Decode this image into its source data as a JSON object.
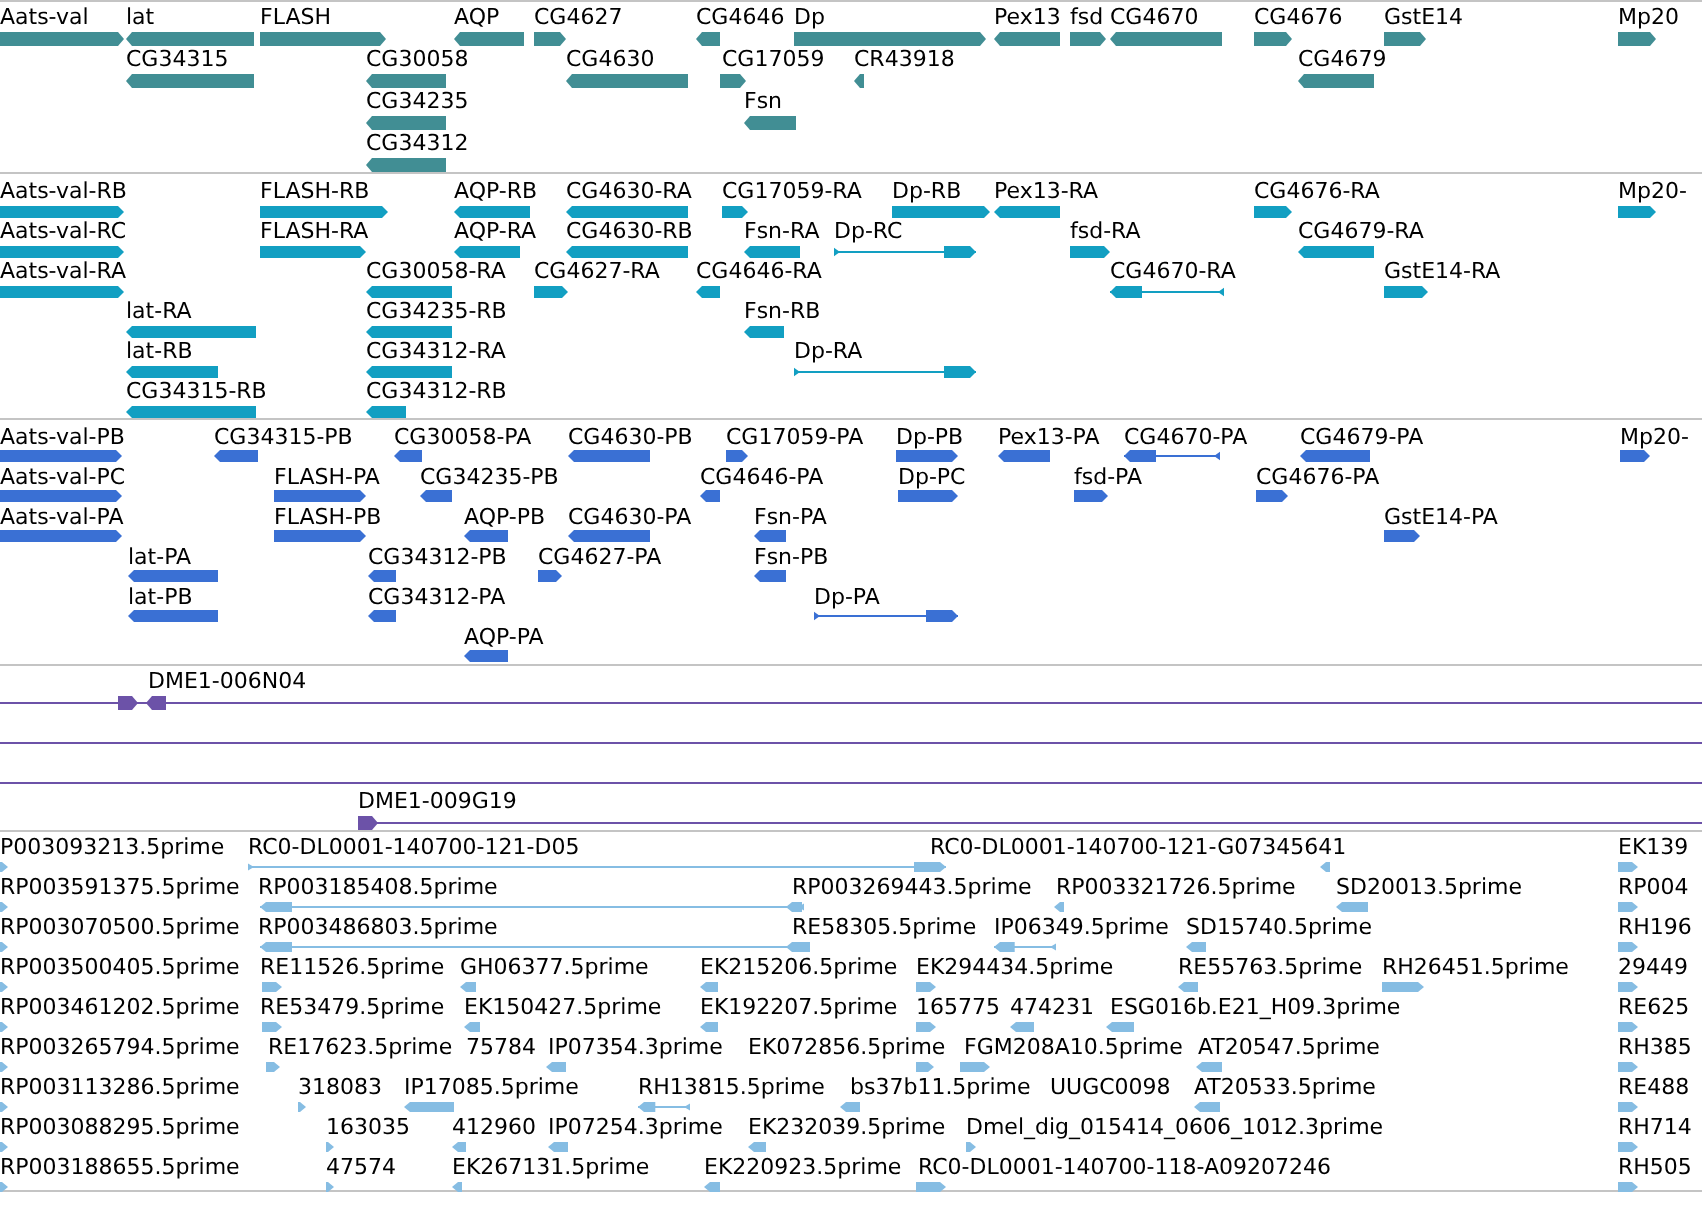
{
  "tracks": [
    {
      "color": "#418e94",
      "rows": [
        {
          "features": [
            {
              "label": "Aats-val",
              "reverse": false
            },
            {
              "label": "lat",
              "reverse": true
            },
            {
              "label": "FLASH",
              "reverse": false
            },
            {
              "label": "AQP",
              "reverse": true
            },
            {
              "label": "CG4627",
              "reverse": false
            },
            {
              "label": "CG4646",
              "reverse": true
            },
            {
              "label": "Dp",
              "reverse": false
            },
            {
              "label": "Pex13",
              "reverse": true
            },
            {
              "label": "fsd",
              "reverse": false
            },
            {
              "label": "CG4670",
              "reverse": true
            },
            {
              "label": "CG4676",
              "reverse": false
            },
            {
              "label": "GstE14",
              "reverse": false
            },
            {
              "label": "Mp20",
              "reverse": false
            }
          ]
        },
        {
          "features": [
            {
              "label": "CG34315",
              "reverse": true
            },
            {
              "label": "CG30058",
              "reverse": true
            },
            {
              "label": "CG4630",
              "reverse": true
            },
            {
              "label": "CG17059",
              "reverse": false
            },
            {
              "label": "CR43918",
              "reverse": true
            },
            {
              "label": "CG4679",
              "reverse": true
            }
          ]
        },
        {
          "features": [
            {
              "label": "CG34235",
              "reverse": true
            },
            {
              "label": "Fsn",
              "reverse": true
            }
          ]
        },
        {
          "features": [
            {
              "label": "CG34312",
              "reverse": true
            }
          ]
        }
      ]
    },
    {
      "color": "#129fc2",
      "rows": [
        {
          "features": [
            {
              "label": "Aats-val-RB",
              "reverse": false
            },
            {
              "label": "FLASH-RB",
              "reverse": false
            },
            {
              "label": "AQP-RB",
              "reverse": true
            },
            {
              "label": "CG4630-RA",
              "reverse": true
            },
            {
              "label": "CG17059-RA",
              "reverse": false
            },
            {
              "label": "Dp-RB",
              "reverse": false
            },
            {
              "label": "Pex13-RA",
              "reverse": true
            },
            {
              "label": "CG4676-RA",
              "reverse": false
            },
            {
              "label": "Mp20-",
              "reverse": false
            }
          ]
        },
        {
          "features": [
            {
              "label": "Aats-val-RC",
              "reverse": false
            },
            {
              "label": "FLASH-RA",
              "reverse": false
            },
            {
              "label": "AQP-RA",
              "reverse": true
            },
            {
              "label": "CG4630-RB",
              "reverse": true
            },
            {
              "label": "Fsn-RA",
              "reverse": true
            },
            {
              "label": "Dp-RC",
              "reverse": false
            },
            {
              "label": "fsd-RA",
              "reverse": false
            },
            {
              "label": "CG4679-RA",
              "reverse": true
            }
          ]
        },
        {
          "features": [
            {
              "label": "Aats-val-RA",
              "reverse": false
            },
            {
              "label": "CG30058-RA",
              "reverse": true
            },
            {
              "label": "CG4627-RA",
              "reverse": false
            },
            {
              "label": "CG4646-RA",
              "reverse": true
            },
            {
              "label": "CG4670-RA",
              "reverse": true
            },
            {
              "label": "GstE14-RA",
              "reverse": false
            }
          ]
        },
        {
          "features": [
            {
              "label": "lat-RA",
              "reverse": true
            },
            {
              "label": "CG34235-RB",
              "reverse": true
            },
            {
              "label": "Fsn-RB",
              "reverse": true
            }
          ]
        },
        {
          "features": [
            {
              "label": "lat-RB",
              "reverse": true
            },
            {
              "label": "CG34312-RA",
              "reverse": true
            },
            {
              "label": "Dp-RA",
              "reverse": false
            }
          ]
        },
        {
          "features": [
            {
              "label": "CG34315-RB",
              "reverse": true
            },
            {
              "label": "CG34312-RB",
              "reverse": true
            }
          ]
        }
      ]
    },
    {
      "color": "#3a70d4",
      "rows": [
        {
          "features": [
            {
              "label": "Aats-val-PB",
              "reverse": false
            },
            {
              "label": "CG34315-PB",
              "reverse": true
            },
            {
              "label": "CG30058-PA",
              "reverse": true
            },
            {
              "label": "CG4630-PB",
              "reverse": true
            },
            {
              "label": "CG17059-PA",
              "reverse": false
            },
            {
              "label": "Dp-PB",
              "reverse": false
            },
            {
              "label": "Pex13-PA",
              "reverse": true
            },
            {
              "label": "CG4670-PA",
              "reverse": true
            },
            {
              "label": "CG4679-PA",
              "reverse": true
            },
            {
              "label": "Mp20-",
              "reverse": false
            }
          ]
        },
        {
          "features": [
            {
              "label": "Aats-val-PC",
              "reverse": false
            },
            {
              "label": "FLASH-PA",
              "reverse": false
            },
            {
              "label": "CG34235-PB",
              "reverse": true
            },
            {
              "label": "CG4646-PA",
              "reverse": true
            },
            {
              "label": "Dp-PC",
              "reverse": false
            },
            {
              "label": "fsd-PA",
              "reverse": false
            },
            {
              "label": "CG4676-PA",
              "reverse": false
            }
          ]
        },
        {
          "features": [
            {
              "label": "Aats-val-PA",
              "reverse": false
            },
            {
              "label": "FLASH-PB",
              "reverse": false
            },
            {
              "label": "AQP-PB",
              "reverse": true
            },
            {
              "label": "CG4630-PA",
              "reverse": true
            },
            {
              "label": "Fsn-PA",
              "reverse": true
            },
            {
              "label": "GstE14-PA",
              "reverse": false
            }
          ]
        },
        {
          "features": [
            {
              "label": "lat-PA",
              "reverse": true
            },
            {
              "label": "CG34312-PB",
              "reverse": true
            },
            {
              "label": "CG4627-PA",
              "reverse": false
            },
            {
              "label": "Fsn-PB",
              "reverse": true
            }
          ]
        },
        {
          "features": [
            {
              "label": "lat-PB",
              "reverse": true
            },
            {
              "label": "CG34312-PA",
              "reverse": true
            },
            {
              "label": "Dp-PA",
              "reverse": false
            }
          ]
        },
        {
          "features": [
            {
              "label": "AQP-PA",
              "reverse": true
            }
          ]
        }
      ]
    },
    {
      "color": "#6c52a8",
      "rows": [
        {
          "kind": "span",
          "features": [
            {
              "label": "DME1-006N04"
            }
          ]
        },
        {
          "kind": "span"
        },
        {
          "kind": "span"
        },
        {
          "kind": "span",
          "features": [
            {
              "label": "DME1-009G19"
            }
          ]
        }
      ]
    },
    {
      "color": "#86bde3",
      "rows": [
        {
          "features": [
            {
              "label": "P003093213.5prime",
              "reverse": false
            },
            {
              "label": "RC0-DL0001-140700-121-D05",
              "reverse": false
            },
            {
              "label": "RC0-DL0001-140700-121-G07345641",
              "reverse": true
            },
            {
              "label": "EK139",
              "reverse": false
            }
          ]
        },
        {
          "features": [
            {
              "label": "RP003591375.5prime",
              "reverse": false
            },
            {
              "label": "RP003185408.5prime",
              "reverse": true
            },
            {
              "label": "RP003269443.5prime",
              "reverse": true
            },
            {
              "label": "RP003321726.5prime",
              "reverse": true
            },
            {
              "label": "SD20013.5prime",
              "reverse": true
            },
            {
              "label": "RP004",
              "reverse": false
            }
          ]
        },
        {
          "features": [
            {
              "label": "RP003070500.5prime",
              "reverse": false
            },
            {
              "label": "RP003486803.5prime",
              "reverse": true
            },
            {
              "label": "RE58305.5prime",
              "reverse": true
            },
            {
              "label": "IP06349.5prime",
              "reverse": true
            },
            {
              "label": "SD15740.5prime",
              "reverse": true
            },
            {
              "label": "RH196",
              "reverse": false
            }
          ]
        },
        {
          "features": [
            {
              "label": "RP003500405.5prime",
              "reverse": false
            },
            {
              "label": "RE11526.5prime",
              "reverse": false
            },
            {
              "label": "GH06377.5prime",
              "reverse": true
            },
            {
              "label": "EK215206.5prime",
              "reverse": true
            },
            {
              "label": "EK294434.5prime",
              "reverse": false
            },
            {
              "label": "RE55763.5prime",
              "reverse": true
            },
            {
              "label": "RH26451.5prime",
              "reverse": false
            },
            {
              "label": "29449",
              "reverse": false
            }
          ]
        },
        {
          "features": [
            {
              "label": "RP003461202.5prime",
              "reverse": false
            },
            {
              "label": "RE53479.5prime",
              "reverse": false
            },
            {
              "label": "EK150427.5prime",
              "reverse": true
            },
            {
              "label": "EK192207.5prime",
              "reverse": true
            },
            {
              "label": "165775",
              "reverse": false
            },
            {
              "label": "474231",
              "reverse": true
            },
            {
              "label": "ESG016b.E21_H09.3prime",
              "reverse": true
            },
            {
              "label": "RE625",
              "reverse": false
            }
          ]
        },
        {
          "features": [
            {
              "label": "RP003265794.5prime",
              "reverse": false
            },
            {
              "label": "RE17623.5prime",
              "reverse": false
            },
            {
              "label": "75784"
            },
            {
              "label": "IP07354.3prime",
              "reverse": true
            },
            {
              "label": "EK072856.5prime",
              "reverse": false
            },
            {
              "label": "FGM208A10.5prime",
              "reverse": false
            },
            {
              "label": "AT20547.5prime",
              "reverse": true
            },
            {
              "label": "RH385",
              "reverse": false
            }
          ]
        },
        {
          "features": [
            {
              "label": "RP003113286.5prime",
              "reverse": false
            },
            {
              "label": "318083",
              "reverse": false
            },
            {
              "label": "IP17085.5prime",
              "reverse": true
            },
            {
              "label": "RH13815.5prime",
              "reverse": true
            },
            {
              "label": "bs37b11.5prime",
              "reverse": true
            },
            {
              "label": "UUGC0098"
            },
            {
              "label": "AT20533.5prime",
              "reverse": true
            },
            {
              "label": "RE488",
              "reverse": false
            }
          ]
        },
        {
          "features": [
            {
              "label": "RP003088295.5prime",
              "reverse": false
            },
            {
              "label": "163035",
              "reverse": false
            },
            {
              "label": "412960",
              "reverse": true
            },
            {
              "label": "IP07254.3prime",
              "reverse": true
            },
            {
              "label": "EK232039.5prime",
              "reverse": true
            },
            {
              "label": "Dmel_dig_015414_0606_1012.3prime",
              "reverse": false
            },
            {
              "label": "RH714",
              "reverse": false
            }
          ]
        },
        {
          "features": [
            {
              "label": "RP003188655.5prime",
              "reverse": false
            },
            {
              "label": "47574",
              "reverse": false
            },
            {
              "label": "EK267131.5prime",
              "reverse": true
            },
            {
              "label": "EK220923.5prime",
              "reverse": true
            },
            {
              "label": "RC0-DL0001-140700-118-A09207246",
              "reverse": false
            },
            {
              "label": "RH505",
              "reverse": false
            }
          ]
        }
      ]
    }
  ]
}
